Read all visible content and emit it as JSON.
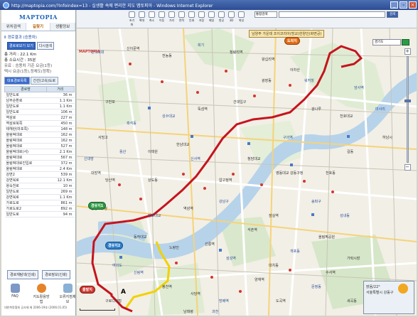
{
  "window": {
    "title": "http://maptopia.com/?Infoindex=13 - 실생활 속에 편리한 지도 맵토피아 - Windows Internet Explorer"
  },
  "sidebar": {
    "logo": "MAPTOPIA",
    "tabs": [
      {
        "label": "위치검색"
      },
      {
        "label": "길찾기"
      },
      {
        "label": "생활정보"
      }
    ],
    "section_title": "Ⅱ 경로결과 (승용차)",
    "buttons": {
      "main": "경로로보기 보기",
      "other": "다시검색"
    },
    "info": {
      "distance": "총 거리 : 22.1 Km",
      "time": "총 소요시간 : 35분",
      "fare": "유료 : 승용차 기준 요금(1등)",
      "fare2": "택시 요금(1등),정체도(정확)"
    },
    "dir_tabs": [
      {
        "label": "대표경로목록"
      },
      {
        "label": "간선(고속)도로"
      }
    ],
    "table": {
      "headers": [
        "경로명",
        "거리"
      ],
      "rows": [
        {
          "name": "일반도로",
          "dist": "36 m"
        },
        {
          "name": "남부순환로",
          "dist": "1.1 Km"
        },
        {
          "name": "일반도로",
          "dist": "1.1 Km"
        },
        {
          "name": "일반도로",
          "dist": "106 m"
        },
        {
          "name": "역삼로",
          "dist": "227 m"
        },
        {
          "name": "역삼로북쪽",
          "dist": "450 m"
        },
        {
          "name": "테헤란(마포쪽)",
          "dist": "148 m"
        },
        {
          "name": "올림픽대로",
          "dist": "162 m"
        },
        {
          "name": "올림픽대로",
          "dist": "162 m"
        },
        {
          "name": "올림픽대로",
          "dist": "527 m"
        },
        {
          "name": "올림픽대로(서)",
          "dist": "2.1 Km"
        },
        {
          "name": "올림픽대로",
          "dist": "567 m"
        },
        {
          "name": "올림픽대로진입로",
          "dist": "372 m"
        },
        {
          "name": "올림픽대로",
          "dist": "2.4 Km"
        },
        {
          "name": "강변2",
          "dist": "539 m"
        },
        {
          "name": "강변북로",
          "dist": "12.1 Km"
        },
        {
          "name": "왕숙천로",
          "dist": "10 m"
        },
        {
          "name": "일반도로",
          "dist": "269 m"
        },
        {
          "name": "강변북로",
          "dist": "1.1 Km"
        },
        {
          "name": "가로도로",
          "dist": "861 m"
        },
        {
          "name": "가로도로2",
          "dist": "892 m"
        },
        {
          "name": "일반도로",
          "dist": "94 m"
        }
      ]
    },
    "bottom_buttons": [
      "경로재탐색(인쇄)",
      "경로정보(인쇄)"
    ],
    "icons": [
      {
        "label": "FAQ"
      },
      {
        "label": "지도활용방법"
      },
      {
        "label": "오류지점제보"
      }
    ],
    "copyright": "대한측량협회 공사제 제 2006-19호 (2006.01.05)"
  },
  "toolbar": {
    "map_logo": "MAPTOPIA",
    "tools": [
      "초기화",
      "확대",
      "축소",
      "이동",
      "거리",
      "면적",
      "인쇄",
      "저장",
      "메일",
      "항공",
      "3D",
      "위성"
    ],
    "search_select": "통합검색",
    "search_button": "검색",
    "location_text": "서울특별시 강동구 암사동"
  },
  "map": {
    "popup": "남양주 가운데 조이코리아(방교)한양인(화면공)",
    "dropdown": "경기도",
    "markers": {
      "start": "출발지",
      "end": "도착지",
      "via1": "경유지1",
      "via2": "경유지2"
    },
    "point_a": "A",
    "minimap": {
      "line1": "맑음/22°",
      "line2": "서울특별시 강동구"
    },
    "labels": [
      "한국외대",
      "신이문역",
      "전농동",
      "회기",
      "청량리역",
      "왕십리역",
      "성수대교",
      "뚝섬역",
      "건대입구",
      "구의역",
      "광나루",
      "천호대교",
      "암사역",
      "길동",
      "강동구청",
      "송파구",
      "잠실역",
      "석촌역",
      "강남구",
      "역삼역",
      "선릉역",
      "삼성역",
      "청담대교",
      "영동대교",
      "반포대교",
      "동작대교",
      "노량진",
      "여의도",
      "영등포구청",
      "당산역",
      "신림역",
      "봉천역",
      "사당역",
      "방배역",
      "양재역",
      "도곡역",
      "워커힐",
      "아차산",
      "광장동",
      "미사리",
      "하남시",
      "천호동",
      "성내동",
      "올림픽공원",
      "가락시장",
      "문정동",
      "세곡동",
      "수서역",
      "개포동",
      "대치동",
      "압구정역",
      "신사역",
      "한남대교",
      "이태원",
      "용산",
      "서빙고",
      "구반포",
      "흑석동",
      "상도동",
      "대방역",
      "신대방",
      "구로디지털",
      "남태령",
      "과천"
    ]
  }
}
